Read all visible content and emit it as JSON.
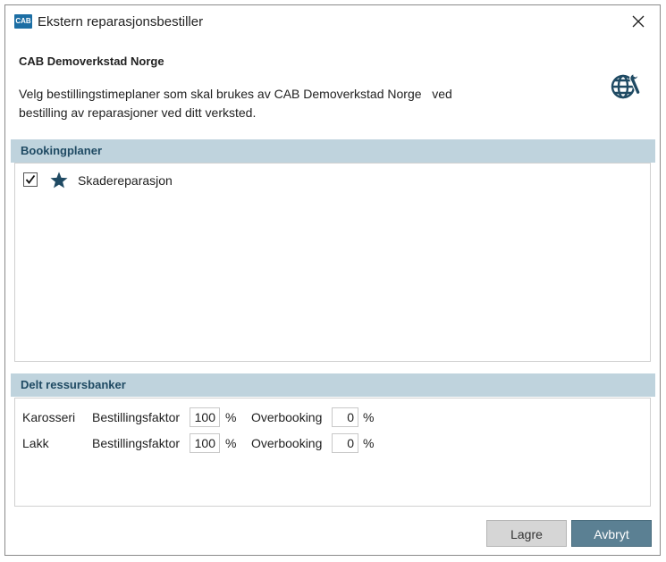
{
  "window": {
    "logo_text": "CAB",
    "title": "Ekstern reparasjonsbestiller"
  },
  "header": {
    "company": "CAB Demoverkstad Norge",
    "description": "Velg bestillingstimeplaner som skal brukes av CAB Demoverkstad Norge   ved\nbestilling av reparasjoner ved ditt verksted.",
    "icon": "globe-wrench-icon"
  },
  "booking": {
    "header": "Bookingplaner",
    "items": [
      {
        "label": "Skadereparasjon",
        "checked": true,
        "icon": "star-icon"
      }
    ]
  },
  "resources": {
    "header": "Delt ressursbanker",
    "factor_label": "Bestillingsfaktor",
    "overbooking_label": "Overbooking",
    "unit": "%",
    "rows": [
      {
        "name": "Karosseri",
        "factor": "100",
        "overbooking": "0"
      },
      {
        "name": "Lakk",
        "factor": "100",
        "overbooking": "0"
      }
    ]
  },
  "buttons": {
    "save": "Lagre",
    "cancel": "Avbryt"
  },
  "colors": {
    "section_header_bg": "#bfd3dd",
    "accent": "#1f4a63",
    "cancel_bg": "#5b8093"
  }
}
